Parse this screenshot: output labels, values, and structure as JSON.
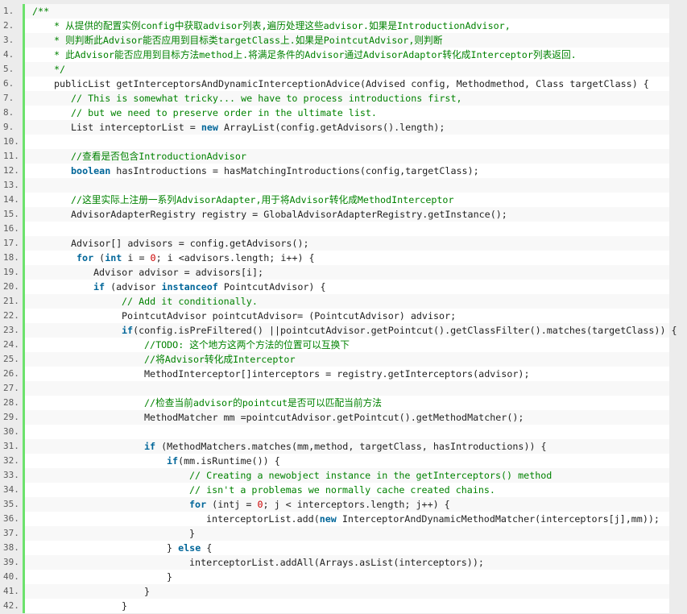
{
  "colors": {
    "comment": "#008200",
    "keyword": "#006699",
    "number": "#cc0000",
    "gutter_border": "#6ce26c"
  },
  "lines": [
    {
      "n": "1.",
      "t": [
        [
          "c",
          "/**"
        ]
      ]
    },
    {
      "n": "2.",
      "t": [
        [
          "c",
          "* 从提供的配置实例config中获取advisor列表,遍历处理这些advisor.如果是IntroductionAdvisor,"
        ]
      ]
    },
    {
      "n": "3.",
      "t": [
        [
          "c",
          "* 则判断此Advisor能否应用到目标类targetClass上.如果是PointcutAdvisor,则判断"
        ]
      ]
    },
    {
      "n": "4.",
      "t": [
        [
          "c",
          "* 此Advisor能否应用到目标方法method上.将满足条件的Advisor通过AdvisorAdaptor转化成Interceptor列表返回."
        ]
      ]
    },
    {
      "n": "5.",
      "t": [
        [
          "c",
          "*/"
        ]
      ]
    },
    {
      "n": "6.",
      "t": [
        [
          "t",
          "publicList getInterceptorsAndDynamicInterceptionAdvice(Advised config, Methodmethod, Class targetClass) {"
        ]
      ]
    },
    {
      "n": "7.",
      "t": [
        [
          "c",
          "// This is somewhat tricky... we have to process introductions first,"
        ]
      ]
    },
    {
      "n": "8.",
      "t": [
        [
          "c",
          "// but we need to preserve order in the ultimate list."
        ]
      ]
    },
    {
      "n": "9.",
      "t": [
        [
          "t",
          "List interceptorList = "
        ],
        [
          "k",
          "new"
        ],
        [
          "t",
          " ArrayList(config.getAdvisors().length);"
        ]
      ]
    },
    {
      "n": "10.",
      "t": []
    },
    {
      "n": "11.",
      "t": [
        [
          "c",
          "//查看是否包含IntroductionAdvisor"
        ]
      ]
    },
    {
      "n": "12.",
      "t": [
        [
          "k",
          "boolean"
        ],
        [
          "t",
          " hasIntroductions = hasMatchingIntroductions(config,targetClass);"
        ]
      ]
    },
    {
      "n": "13.",
      "t": []
    },
    {
      "n": "14.",
      "t": [
        [
          "c",
          "//这里实际上注册一系列AdvisorAdapter,用于将Advisor转化成MethodInterceptor"
        ]
      ]
    },
    {
      "n": "15.",
      "t": [
        [
          "t",
          "AdvisorAdapterRegistry registry = GlobalAdvisorAdapterRegistry.getInstance();"
        ]
      ]
    },
    {
      "n": "16.",
      "t": []
    },
    {
      "n": "17.",
      "t": [
        [
          "t",
          "Advisor[] advisors = config.getAdvisors();"
        ]
      ]
    },
    {
      "n": "18.",
      "t": [
        [
          "k",
          "for"
        ],
        [
          "t",
          " ("
        ],
        [
          "k",
          "int"
        ],
        [
          "t",
          " i = "
        ],
        [
          "n",
          "0"
        ],
        [
          "t",
          "; i <advisors.length; i++) {"
        ]
      ]
    },
    {
      "n": "19.",
      "t": [
        [
          "t",
          "Advisor advisor = advisors[i];"
        ]
      ]
    },
    {
      "n": "20.",
      "t": [
        [
          "k",
          "if"
        ],
        [
          "t",
          " (advisor "
        ],
        [
          "k",
          "instanceof"
        ],
        [
          "t",
          " PointcutAdvisor) {"
        ]
      ]
    },
    {
      "n": "21.",
      "t": [
        [
          "c",
          "// Add it conditionally."
        ]
      ]
    },
    {
      "n": "22.",
      "t": [
        [
          "t",
          "PointcutAdvisor pointcutAdvisor= (PointcutAdvisor) advisor;"
        ]
      ]
    },
    {
      "n": "23.",
      "t": [
        [
          "k",
          "if"
        ],
        [
          "t",
          "(config.isPreFiltered() ||pointcutAdvisor.getPointcut().getClassFilter().matches(targetClass)) {"
        ]
      ]
    },
    {
      "n": "24.",
      "t": [
        [
          "c",
          "//TODO: 这个地方这两个方法的位置可以互换下"
        ]
      ]
    },
    {
      "n": "25.",
      "t": [
        [
          "c",
          "//将Advisor转化成Interceptor"
        ]
      ]
    },
    {
      "n": "26.",
      "t": [
        [
          "t",
          "MethodInterceptor[]interceptors = registry.getInterceptors(advisor);"
        ]
      ]
    },
    {
      "n": "27.",
      "t": []
    },
    {
      "n": "28.",
      "t": [
        [
          "c",
          "//检查当前advisor的pointcut是否可以匹配当前方法"
        ]
      ]
    },
    {
      "n": "29.",
      "t": [
        [
          "t",
          "MethodMatcher mm =pointcutAdvisor.getPointcut().getMethodMatcher();"
        ]
      ]
    },
    {
      "n": "30.",
      "t": []
    },
    {
      "n": "31.",
      "t": [
        [
          "k",
          "if"
        ],
        [
          "t",
          " (MethodMatchers.matches(mm,method, targetClass, hasIntroductions)) {"
        ]
      ]
    },
    {
      "n": "32.",
      "t": [
        [
          "k",
          "if"
        ],
        [
          "t",
          "(mm.isRuntime()) {"
        ]
      ]
    },
    {
      "n": "33.",
      "t": [
        [
          "c",
          "// Creating a newobject instance in the getInterceptors() method"
        ]
      ]
    },
    {
      "n": "34.",
      "t": [
        [
          "c",
          "// isn't a problemas we normally cache created chains."
        ]
      ]
    },
    {
      "n": "35.",
      "t": [
        [
          "k",
          "for"
        ],
        [
          "t",
          " (intj = "
        ],
        [
          "n",
          "0"
        ],
        [
          "t",
          "; j < interceptors.length; j++) {"
        ]
      ]
    },
    {
      "n": "36.",
      "t": [
        [
          "t",
          "interceptorList.add("
        ],
        [
          "k",
          "new"
        ],
        [
          "t",
          " InterceptorAndDynamicMethodMatcher(interceptors[j],mm));"
        ]
      ]
    },
    {
      "n": "37.",
      "t": [
        [
          "t",
          "}"
        ]
      ]
    },
    {
      "n": "38.",
      "t": [
        [
          "t",
          "} "
        ],
        [
          "k",
          "else"
        ],
        [
          "t",
          " {"
        ]
      ]
    },
    {
      "n": "39.",
      "t": [
        [
          "t",
          "interceptorList.addAll(Arrays.asList(interceptors));"
        ]
      ]
    },
    {
      "n": "40.",
      "t": [
        [
          "t",
          "}"
        ]
      ]
    },
    {
      "n": "41.",
      "t": [
        [
          "t",
          "}"
        ]
      ]
    },
    {
      "n": "42.",
      "t": [
        [
          "t",
          "}"
        ]
      ]
    }
  ]
}
